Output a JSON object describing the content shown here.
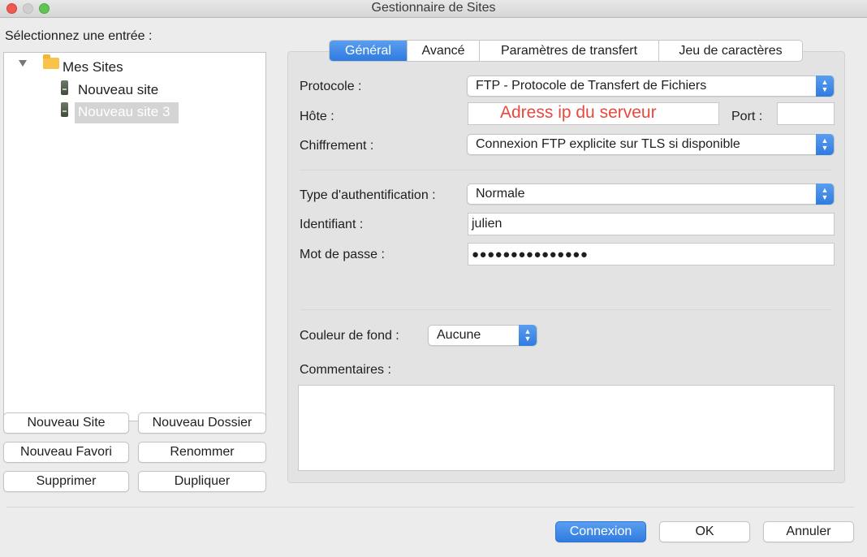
{
  "window": {
    "title": "Gestionnaire de Sites"
  },
  "tree": {
    "header": "Sélectionnez une entrée :",
    "root_label": "Mes Sites",
    "items": [
      {
        "label": "Nouveau site",
        "selected": false
      },
      {
        "label": "Nouveau site 3",
        "selected": true
      }
    ]
  },
  "left_buttons": {
    "new_site": "Nouveau Site",
    "new_folder": "Nouveau Dossier",
    "new_bookmark": "Nouveau Favori",
    "rename": "Renommer",
    "delete": "Supprimer",
    "duplicate": "Dupliquer"
  },
  "tabs": [
    {
      "label": "Général",
      "active": true
    },
    {
      "label": "Avancé",
      "active": false
    },
    {
      "label": "Paramètres de transfert",
      "active": false
    },
    {
      "label": "Jeu de caractères",
      "active": false
    }
  ],
  "general": {
    "protocol_label": "Protocole :",
    "protocol_value": "FTP - Protocole de Transfert de Fichiers",
    "host_label": "Hôte :",
    "host_value": "",
    "host_hint": "Adress ip du serveur",
    "port_label": "Port :",
    "port_value": "",
    "encryption_label": "Chiffrement :",
    "encryption_value": "Connexion FTP explicite sur TLS si disponible",
    "auth_type_label": "Type d'authentification :",
    "auth_type_value": "Normale",
    "username_label": "Identifiant :",
    "username_value": "julien",
    "password_label": "Mot de passe :",
    "password_value": "●●●●●●●●●●●●●●●",
    "bg_color_label": "Couleur de fond :",
    "bg_color_value": "Aucune",
    "comments_label": "Commentaires :",
    "comments_value": ""
  },
  "footer": {
    "connect": "Connexion",
    "ok": "OK",
    "cancel": "Annuler"
  },
  "colors": {
    "accent": "#3b87e8",
    "hint_red": "#e8493f",
    "folder": "#f8c24b"
  }
}
